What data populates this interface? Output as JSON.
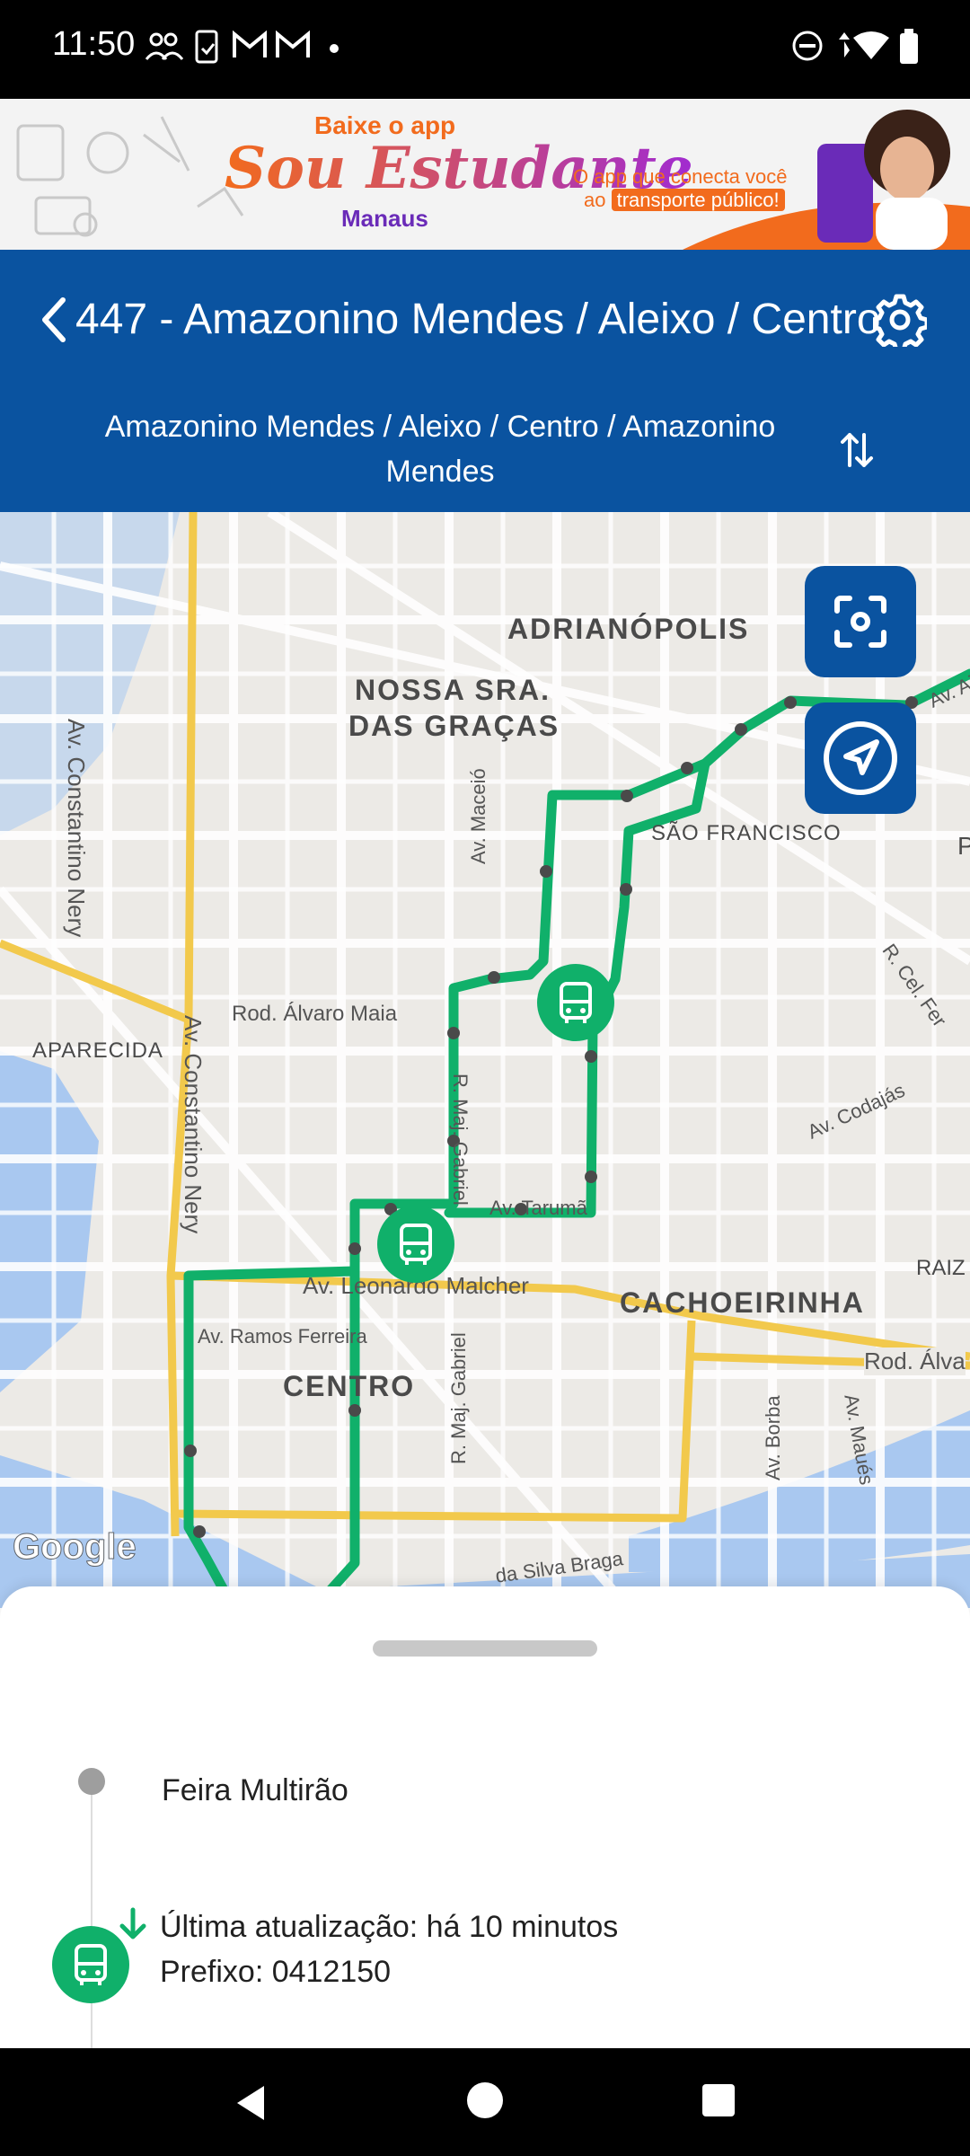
{
  "status_bar": {
    "time": "11:50",
    "icons": [
      "people-icon",
      "sim-icon",
      "gmail-icon",
      "gmail-icon",
      "dot-icon",
      "do-not-disturb-icon",
      "wifi-icon",
      "battery-icon"
    ]
  },
  "ad_banner": {
    "line1": "Baixe o app",
    "brand_script": "Sou Estudante",
    "city": "Manaus",
    "tagline_1": "O app que conecta você",
    "tagline_2_prefix": "ao",
    "tagline_highlight": "transporte público!"
  },
  "header": {
    "route_title": "447 - Amazonino Mendes / Aleixo / Centro",
    "direction": "Amazonino Mendes / Aleixo / Centro / Amazonino Mendes",
    "back_icon": "chevron-left-icon",
    "settings_icon": "gear-icon",
    "swap_icon": "swap-vertical-icon"
  },
  "map": {
    "neighborhoods": [
      "ADRIANÓPOLIS",
      "NOSSA SRA.",
      "DAS GRAÇAS",
      "SÃO FRANCISCO",
      "APARECIDA",
      "CENTRO",
      "CACHOEIRINHA",
      "RAIZ",
      "P"
    ],
    "streets": [
      "Av. Constantino Nery",
      "Av. Constantino Nery",
      "Av. Maceió",
      "Rod. Álvaro Maia",
      "R. Maj. Gabriel",
      "R. Maj. Gabriel",
      "Av. Tarumã",
      "Av. Leonardo Malcher",
      "Av. Ramos Ferreira",
      "Av. Borba",
      "Av. Maués",
      "Rod. Álva",
      "R. Cel. Fer",
      "Av. Codajás",
      "Av. Ai",
      "da Silva Braga"
    ],
    "attribution": "Google",
    "route_color": "#10b06a",
    "buttons": [
      "focus-icon",
      "navigation-icon"
    ]
  },
  "sheet": {
    "stop_name": "Feira Multirão",
    "last_update": "Última atualização: há 10 minutos",
    "prefix": "Prefixo: 0412150"
  },
  "colors": {
    "primary": "#0a53a0",
    "accent": "#10b06a"
  }
}
